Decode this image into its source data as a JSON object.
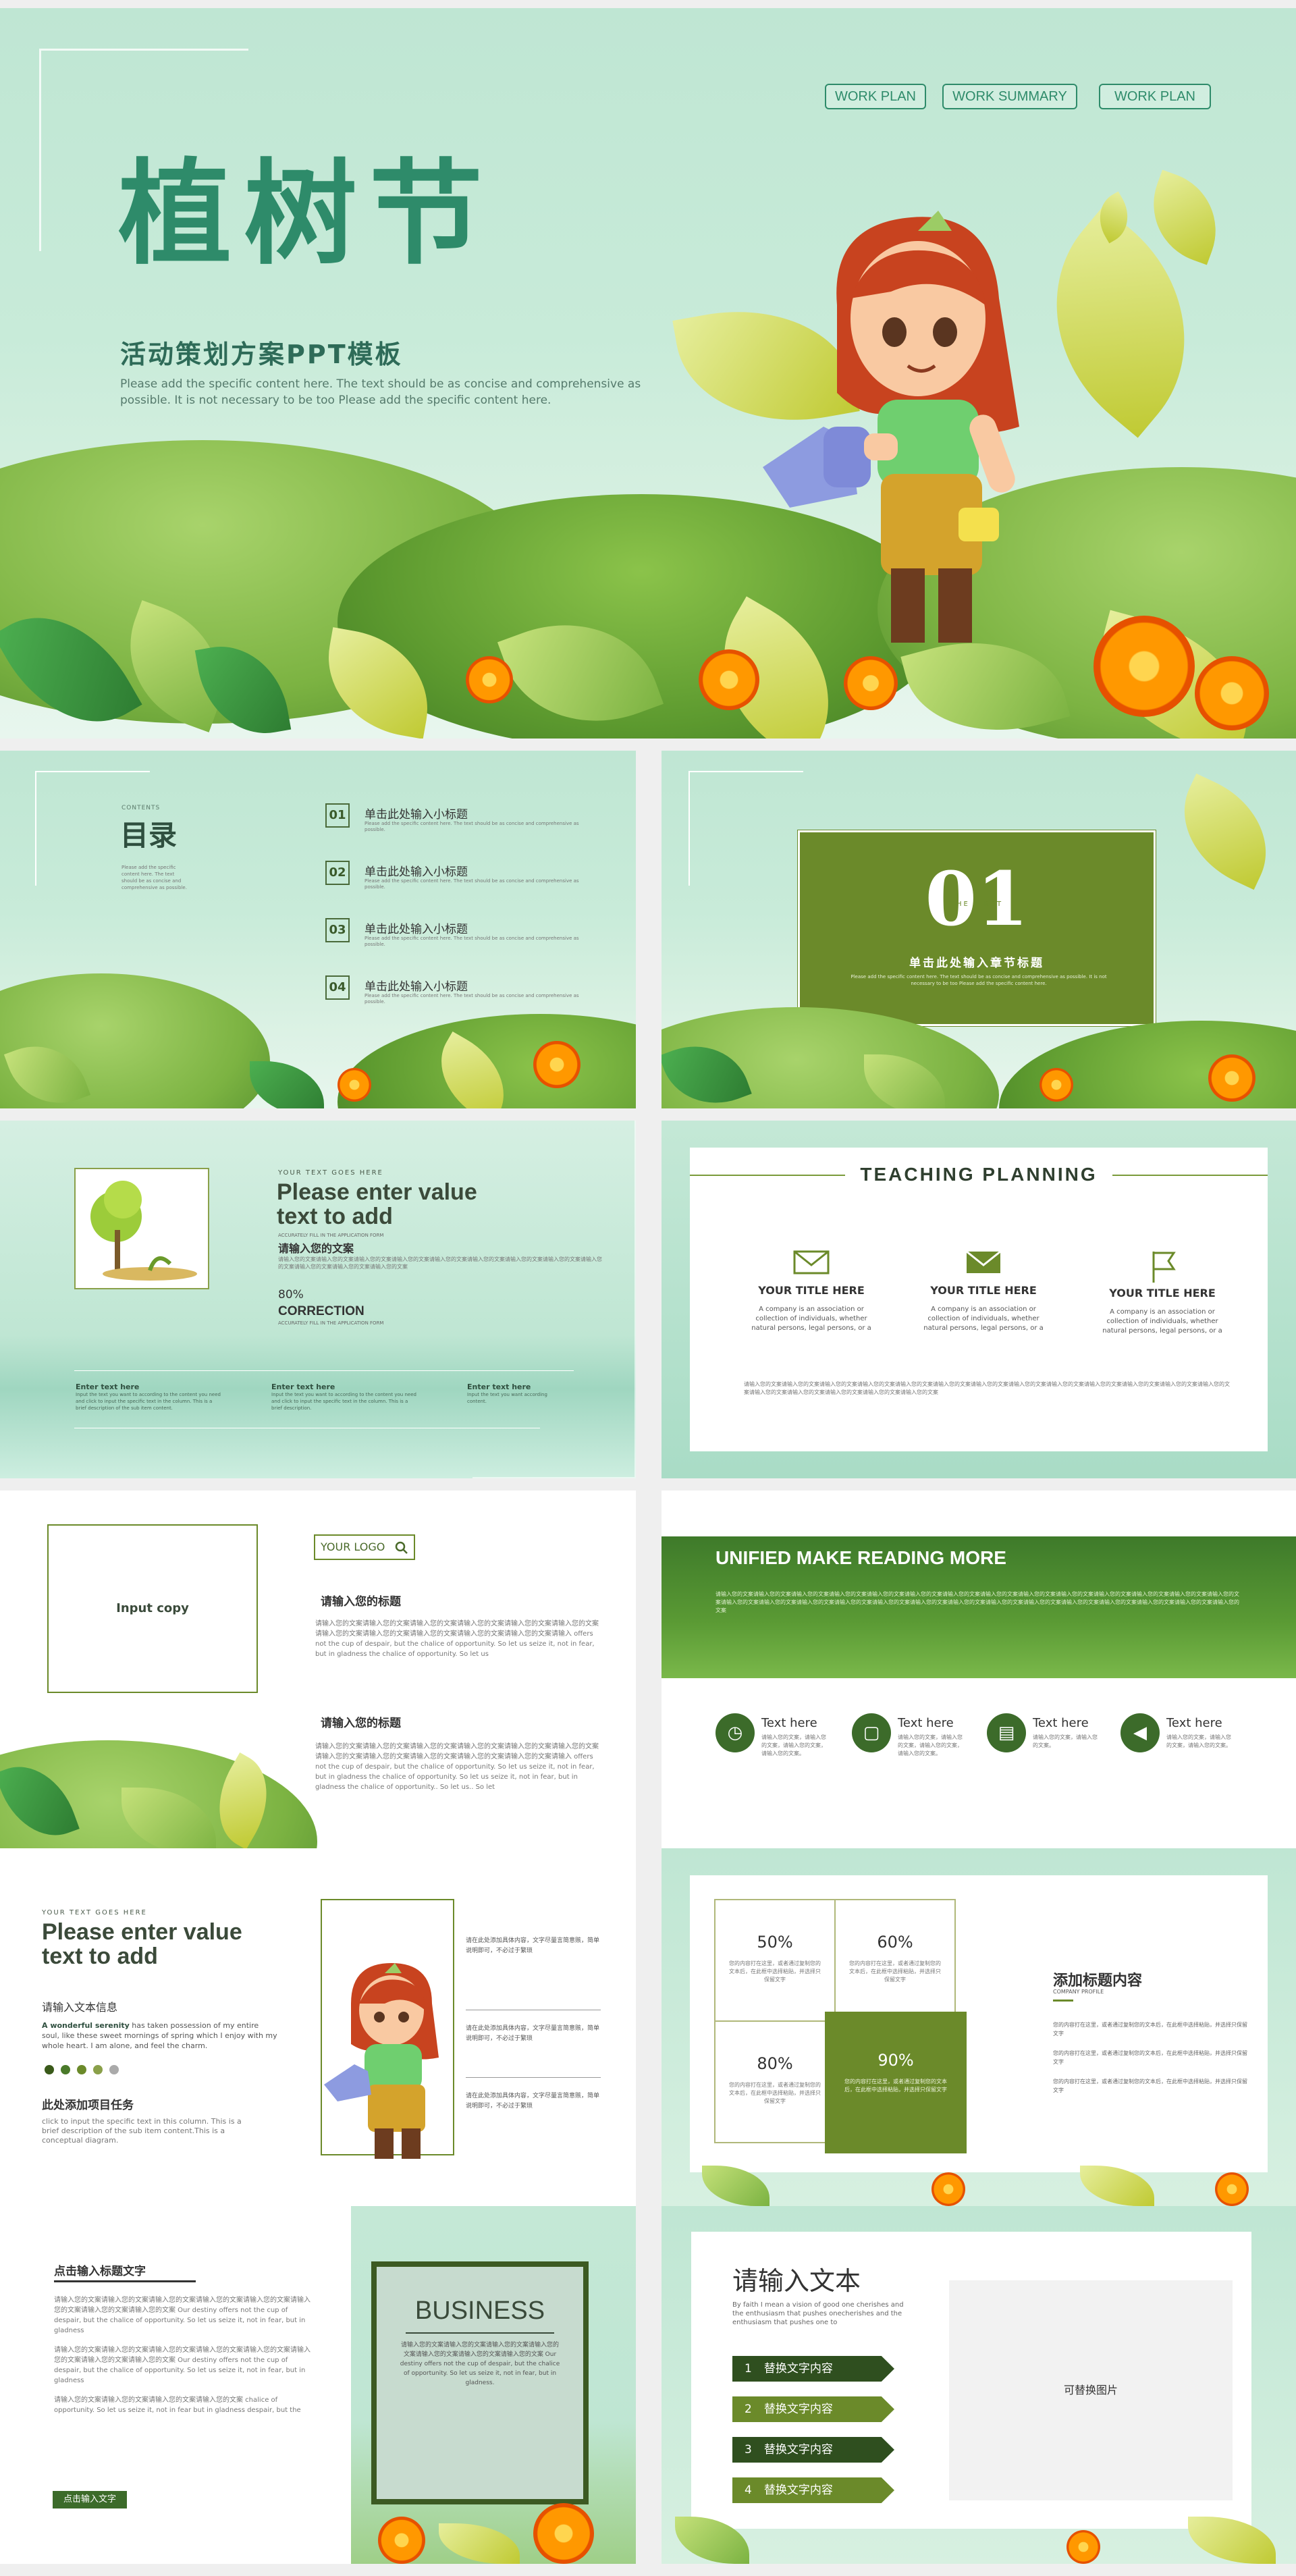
{
  "cover": {
    "tabs": [
      "WORK PLAN",
      "WORK SUMMARY",
      "WORK PLAN"
    ],
    "title": "植树节",
    "subtitle": "活动策划方案PPT模板",
    "desc": "Please add the specific content here. The text should be as concise and comprehensive as possible. It is not necessary to be too Please add the specific content here."
  },
  "contents": {
    "label": "CONTENTS",
    "title": "目录",
    "side_text": "Please add the specific content here. The text should be as concise and comprehensive as possible.",
    "items": [
      {
        "num": "01",
        "title": "单击此处输入小标题",
        "desc": "Please add the specific content here. The text should be as concise and comprehensive as possible."
      },
      {
        "num": "02",
        "title": "单击此处输入小标题",
        "desc": "Please add the specific content here. The text should be as concise and comprehensive as possible."
      },
      {
        "num": "03",
        "title": "单击此处输入小标题",
        "desc": "Please add the specific content here. The text should be as concise and comprehensive as possible."
      },
      {
        "num": "04",
        "title": "单击此处输入小标题",
        "desc": "Please add the specific content here. The text should be as concise and comprehensive as possible."
      }
    ]
  },
  "section": {
    "num": "01",
    "small": "THE FIRST",
    "title": "单击此处输入章节标题",
    "desc": "Please add the specific content here. The text should be as concise and comprehensive as possible. It is not necessary to be too Please add the specific content here."
  },
  "intro": {
    "kicker": "YOUR TEXT GOES HERE",
    "title_l1": "Please enter value",
    "title_l2": "text to add",
    "sub": "ACCURATELY FILL IN THE APPLICATION FORM",
    "cn": "请输入您的文案",
    "body": "请输入您的文案请输入您的文案请输入您的文案请输入您的文案请输入您的文案请输入您的文案请输入您的文案请输入您的文案请输入您的文案请输入您的文案请输入您的文案请输入您的文案",
    "pct": "80%",
    "corr": "CORRECTION",
    "corr_sub": "ACCURATELY FILL IN THE APPLICATION FORM",
    "cols": [
      {
        "h": "Enter text here",
        "t": "Input the text you want to according to the content you need and click to input the specific text in the column. This is a brief description of the sub item content."
      },
      {
        "h": "Enter text here",
        "t": "Input the text you want to according to the content you need and click to input the specific text in the column. This is a brief description."
      },
      {
        "h": "Enter text here",
        "t": "Input the text you want according content."
      }
    ]
  },
  "teaching": {
    "title": "TEACHING PLANNING",
    "items": [
      {
        "h": "YOUR TITLE HERE",
        "t": "A company is an association or collection of individuals, whether natural persons, legal persons, or a"
      },
      {
        "h": "YOUR TITLE HERE",
        "t": "A company is an association or collection of individuals, whether natural persons, legal persons, or a"
      },
      {
        "h": "YOUR TITLE HERE",
        "t": "A company is an association or collection of individuals, whether natural persons, legal persons, or a"
      }
    ],
    "footer": "请输入您的文案请输入您的文案请输入您的文案请输入您的文案请输入您的文案请输入您的文案请输入您的文案请输入您的文案请输入您的文案请输入您的文案请输入您的文案请输入您的文案请输入您的文案请输入您的文案请输入您的文案请输入您的文案请输入您的文案请输入您的文案"
  },
  "logo_slide": {
    "input_copy": "Input copy",
    "logo": "YOUR LOGO",
    "h1": "请输入您的标题",
    "b1": "请输入您的文案请输入您的文案请输入您的文案请输入您的文案请输入您的文案请输入您的文案请输入您的文案请输入您的文案请输入您的文案请输入您的文案请输入您的文案请输入 offers not the cup of despair, but the chalice of opportunity. So let us seize it, not in fear, but in gladness the chalice of opportunity. So let us",
    "h2": "请输入您的标题",
    "b2": "请输入您的文案请输入您的文案请输入您的文案请输入您的文案请输入您的文案请输入您的文案请输入您的文案请输入您的文案请输入您的文案请输入您的文案请输入您的文案请输入 offers not the cup of despair, but the chalice of opportunity. So let us seize it, not in fear, but in gladness the chalice of opportunity. So let us seize it, not in fear, but in gladness the chalice of opportunity.. So let us.. So let"
  },
  "unified": {
    "title": "UNIFIED MAKE READING MORE",
    "body": "请输入您的文案请输入您的文案请输入您的文案请输入您的文案请输入您的文案请输入您的文案请输入您的文案请输入您的文案请输入您的文案请输入您的文案请输入您的文案请输入您的文案请输入您的文案请输入您的文案请输入您的文案请输入您的文案请输入您的文案请输入您的文案请输入您的文案请输入您的文案请输入您的文案请输入您的文案请输入您的文案请输入您的文案请输入您的文案请输入您的文案请输入您的文案请输入您的文案",
    "items": [
      {
        "h": "Text here",
        "t": "请输入您的文案，请输入您的文案，请输入您的文案，请输入您的文案。"
      },
      {
        "h": "Text here",
        "t": "请输入您的文案，请输入您的文案，请输入您的文案，请输入您的文案。"
      },
      {
        "h": "Text here",
        "t": "请输入您的文案，请输入您的文案。"
      },
      {
        "h": "Text here",
        "t": "请输入您的文案，请输入您的文案，请输入您的文案。"
      }
    ]
  },
  "girl_slide": {
    "kicker": "YOUR TEXT GOES HERE",
    "title_l1": "Please enter value",
    "title_l2": "text to add",
    "info_h": "请输入文本信息",
    "info_bold": "A wonderful serenity",
    "info_t": " has taken possession of my entire soul, like these sweet mornings of spring which I enjoy with my whole heart. I am alone, and feel the charm.",
    "task_h": "此处添加项目任务",
    "task_t": "click to input the specific text in this column. This is a brief description of the sub item content.This is a conceptual diagram.",
    "right_items": [
      "请在此处添加具体内容，文字尽量言简意赅，简单说明即可，不必过于繁琐",
      "请在此处添加具体内容，文字尽量言简意赅，简单说明即可，不必过于繁琐",
      "请在此处添加具体内容，文字尽量言简意赅，简单说明即可，不必过于繁琐"
    ]
  },
  "percent_slide": {
    "cells": [
      {
        "p": "50%",
        "t": "您的内容打在这里，或者通过复制您的文本后，在此框中选择粘贴，并选择只保留文字"
      },
      {
        "p": "60%",
        "t": "您的内容打在这里，或者通过复制您的文本后，在此框中选择粘贴，并选择只保留文字"
      },
      {
        "p": "80%",
        "t": "您的内容打在这里，或者通过复制您的文本后，在此框中选择粘贴，并选择只保留文字"
      },
      {
        "p": "90%",
        "t": "您的内容打在这里，或者通过复制您的文本后，在此框中选择粘贴，并选择只保留文字"
      }
    ],
    "title": "添加标题内容",
    "sub": "COMPANY PROFILE",
    "paras": [
      "您的内容打在这里，或者通过复制您的文本后，在此框中选择粘贴，并选择只保留文字",
      "您的内容打在这里，或者通过复制您的文本后，在此框中选择粘贴，并选择只保留文字",
      "您的内容打在这里，或者通过复制您的文本后，在此框中选择粘贴，并选择只保留文字"
    ]
  },
  "business": {
    "h": "点击输入标题文字",
    "paras": [
      "请输入您的文案请输入您的文案请输入您的文案请输入您的文案请输入您的文案请输入您的文案请输入您的文案请输入您的文案 Our destiny offers not the cup of despair, but the chalice of opportunity. So let us seize it, not in fear, but in gladness",
      "请输入您的文案请输入您的文案请输入您的文案请输入您的文案请输入您的文案请输入您的文案请输入您的文案请输入您的文案 Our destiny offers not the cup of despair, but the chalice of opportunity. So let us seize it, not in fear, but in gladness",
      "请输入您的文案请输入您的文案请输入您的文案请输入您的文案 chalice of opportunity. So let us seize it, not in fear but in gladness despair, but the"
    ],
    "btn": "点击输入文字",
    "box_title": "BUSINESS",
    "box_text": "请输入您的文案请输入您的文案请输入您的文案请输入您的文案请输入您的文案请输入您的文案请输入您的文案 Our destiny offers not the cup of despair, but the chalice of opportunity. So let us seize it, not in fear, but in gladness."
  },
  "final": {
    "title": "请输入文本",
    "desc": "By faith I mean a vision of good one cherishes and the enthusiasm that pushes onecherishes and the enthusiasm that pushes one to",
    "items": [
      "替换文字内容",
      "替换文字内容",
      "替换文字内容",
      "替换文字内容"
    ],
    "image_ph": "可替换图片"
  }
}
